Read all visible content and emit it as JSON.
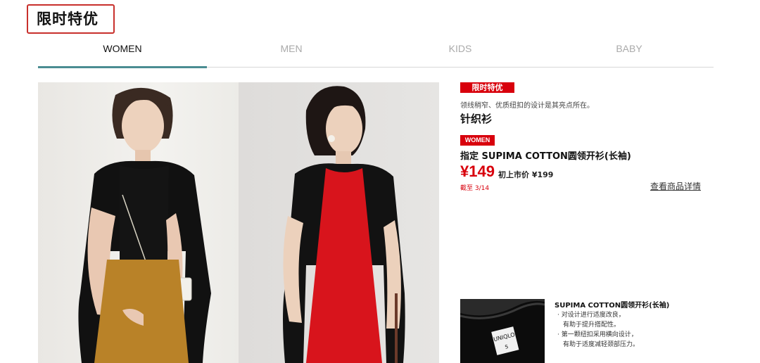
{
  "page": {
    "title": "限时特优"
  },
  "tabs": [
    {
      "label": "WOMEN",
      "active": true
    },
    {
      "label": "MEN",
      "active": false
    },
    {
      "label": "KIDS",
      "active": false
    },
    {
      "label": "BABY",
      "active": false
    }
  ],
  "product": {
    "flash_badge": "限时特优",
    "description": "领线稍窄、优质纽扣的设计是其亮点所在。",
    "category": "针织衫",
    "gender_badge": "WOMEN",
    "name": "指定 SUPIMA COTTON圆领开衫(长袖)",
    "price": "¥149",
    "original_price": "初上市价 ¥199",
    "deadline": "截至 3/14",
    "details_link": "查看商品详情"
  },
  "feature": {
    "thumb_tag": "UNIQLO",
    "title": "SUPIMA COTTON圆领开衫(长袖)",
    "lines": [
      "· 对设计进行适度改良，",
      "有助于提升搭配性。",
      "· 第一颗纽扣采用横向设计，",
      "有助于适度减轻颈部压力。"
    ]
  },
  "colors": {
    "accent_red": "#d8000c",
    "tab_underline": "#4a8d92",
    "title_box": "#c8302c"
  }
}
